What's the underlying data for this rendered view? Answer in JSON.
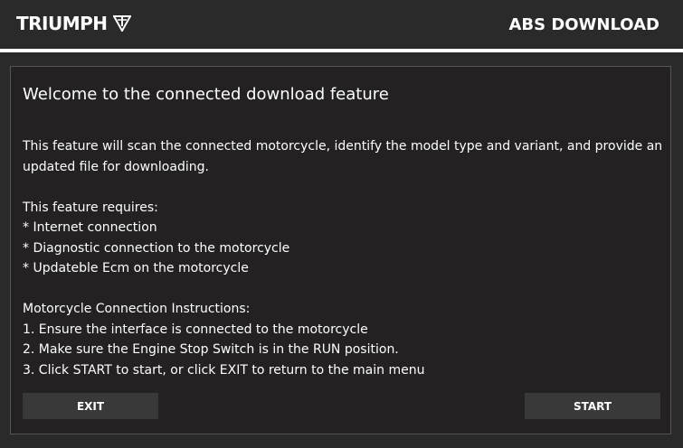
{
  "header": {
    "brand": "TRIUMPH",
    "logo_icon": "triumph-triangle-icon",
    "title": "ABS DOWNLOAD"
  },
  "panel": {
    "welcome": "Welcome to the connected download feature",
    "lines": [
      "This feature will scan the connected motorcycle, identify the model type and variant, and provide an",
      "updated file for downloading.",
      "This feature requires:",
      "* Internet connection",
      "* Diagnostic connection to the motorcycle",
      "* Updateble Ecm on the motorcycle",
      "Motorcycle Connection Instructions:",
      "1. Ensure the interface is connected to the motorcycle",
      "2. Make sure the Engine Stop Switch is in the RUN position.",
      "3. Click START to start, or click EXIT to return to the main menu"
    ]
  },
  "buttons": {
    "exit_label": "EXIT",
    "start_label": "START"
  },
  "colors": {
    "background": "#2b2a2a",
    "panel": "#232121",
    "button": "#3a3939",
    "text": "#ffffff"
  }
}
